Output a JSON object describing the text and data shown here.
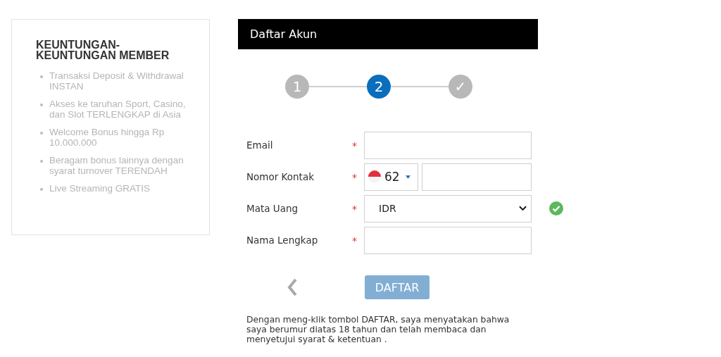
{
  "benefits": {
    "title": "KEUNTUNGAN-KEUNTUNGAN MEMBER",
    "items": [
      "Transaksi Deposit & Withdrawal INSTAN",
      "Akses ke taruhan Sport, Casino, dan Slot TERLENGKAP di Asia",
      "Welcome Bonus hingga Rp 10.000.000",
      "Beragam bonus lainnya dengan syarat turnover TERENDAH",
      "Live Streaming GRATIS"
    ]
  },
  "form": {
    "title": "Daftar Akun",
    "steps": [
      {
        "label": "1",
        "selected": false
      },
      {
        "label": "2",
        "selected": true
      },
      {
        "label": "✓",
        "selected": false
      }
    ],
    "fields": [
      {
        "kind": "text",
        "label": "Email",
        "required_mark": "*"
      },
      {
        "kind": "phone",
        "label": "Nomor Kontak",
        "required_mark": "*",
        "code": "62"
      },
      {
        "kind": "select",
        "label": "Mata Uang",
        "required_mark": "*",
        "value": "IDR",
        "valid": true
      },
      {
        "kind": "text",
        "label": "Nama Lengkap",
        "required_mark": "*"
      }
    ],
    "submit": {
      "label": "DAFTAR",
      "disabled": true
    },
    "terms": "Dengan meng-klik tombol DAFTAR, saya menyatakan bahwa saya berumur diatas 18 tahun dan telah membaca dan menyetujui syarat & ketentuan ."
  }
}
